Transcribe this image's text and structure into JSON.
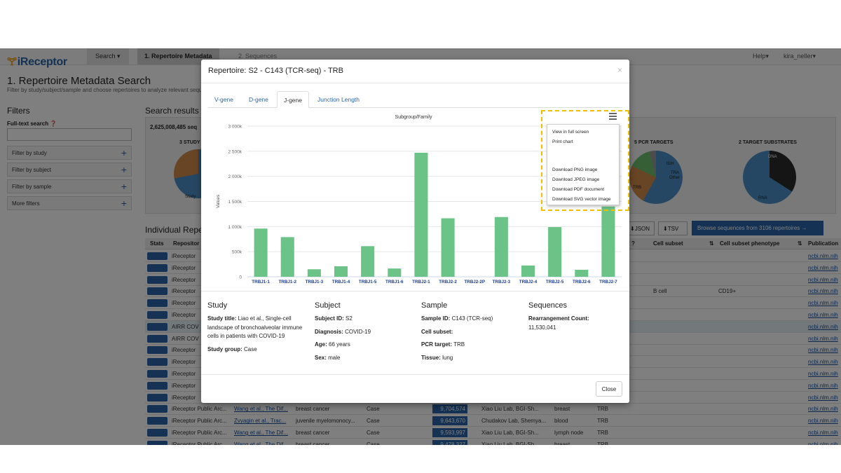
{
  "app": {
    "logo": "iReceptor",
    "nav": {
      "search": "Search ▾",
      "step1": "1. Repertoire Metadata",
      "step2": "2. Sequences",
      "help": "Help▾",
      "user": "kira_neller▾"
    },
    "page_title": "1. Repertoire Metadata Search",
    "page_subtitle": "Filter by study/subject/sample and choose repertoires to analyze relevant sequences.",
    "filters": {
      "heading": "Filters",
      "fulltext_label": "Full-text search",
      "rows": [
        "Filter by study",
        "Filter by subject",
        "Filter by sample",
        "More filters"
      ]
    },
    "results": {
      "heading": "Search results",
      "count": "2,625,008,485 seq",
      "pies": [
        {
          "title": "3 STUDY",
          "labels": [
            "Study"
          ]
        },
        {
          "title": "5 PCR TARGETS",
          "labels": [
            "IGH",
            "TRA",
            "Other",
            "TRB"
          ]
        },
        {
          "title": "2 TARGET SUBSTRATES",
          "labels": [
            "DNA",
            "RNA"
          ]
        }
      ]
    },
    "individual": {
      "heading": "Individual Repe",
      "json_btn": "JSON",
      "tsv_btn": "TSV",
      "browse_btn": "Browse sequences from 3106 repertoires →"
    },
    "table": {
      "headers": {
        "stats": "Stats",
        "repository": "Repositor",
        "q1": "?",
        "cell_subset": "Cell subset",
        "cell_phenotype": "Cell subset phenotype",
        "publication": "Publication"
      },
      "rows": [
        {
          "repo": "iReceptor",
          "pub": "ncbi.nlm.nih"
        },
        {
          "repo": "iReceptor",
          "pub": "ncbi.nlm.nih"
        },
        {
          "repo": "iReceptor",
          "pub": "ncbi.nlm.nih"
        },
        {
          "repo": "iReceptor",
          "cell": "B cell",
          "phen": "CD19+",
          "pub": "ncbi.nlm.nih"
        },
        {
          "repo": "iReceptor",
          "pub": "ncbi.nlm.nih"
        },
        {
          "repo": "iReceptor",
          "pub": "ncbi.nlm.nih"
        },
        {
          "repo": "AIRR COV",
          "pub": "ncbi.nlm.nih",
          "highlight": true
        },
        {
          "repo": "AIRR COV",
          "pub": "ncbi.nlm.nih"
        },
        {
          "repo": "iReceptor",
          "pub": "ncbi.nlm.nih"
        },
        {
          "repo": "iReceptor",
          "pub": "ncbi.nlm.nih"
        },
        {
          "repo": "iReceptor",
          "pub": "ncbi.nlm.nih"
        },
        {
          "repo": "iReceptor",
          "pub": "ncbi.nlm.nih"
        },
        {
          "repo": "iReceptor",
          "pub": "ncbi.nlm.nih"
        },
        {
          "repo": "iReceptor Public Arc...",
          "study": "Wang et al., The Dif...",
          "disease": "breast cancer",
          "group": "Case",
          "seq": "9,704,574",
          "lab": "Xiao Liu Lab, BGI-Sh...",
          "tissue": "breast",
          "target": "TRB",
          "pub": "ncbi.nlm.nih"
        },
        {
          "repo": "iReceptor Public Arc...",
          "study": "Zvyagin et al., Trac...",
          "disease": "juvenile myelomonocy...",
          "group": "Case",
          "seq": "9,643,670",
          "lab": "Chudakov Lab, Shemya...",
          "tissue": "blood",
          "target": "TRB",
          "pub": "ncbi.nlm.nih"
        },
        {
          "repo": "iReceptor Public Arc...",
          "study": "Wang et al., The Dif...",
          "disease": "breast cancer",
          "group": "Case",
          "seq": "9,593,997",
          "lab": "Xiao Liu Lab, BGI-Sh...",
          "tissue": "lymph node",
          "target": "TRB",
          "pub": "ncbi.nlm.nih"
        },
        {
          "repo": "iReceptor Public Arc...",
          "study": "Wang et al., The Dif...",
          "disease": "breast cancer",
          "group": "Case",
          "seq": "9,478,327",
          "lab": "Xiao Liu Lab, BGI-Sh...",
          "tissue": "breast",
          "target": "TRB",
          "pub": "ncbi.nlm.nih"
        }
      ]
    }
  },
  "modal": {
    "title": "Repertoire: S2 - C143 (TCR-seq) - TRB",
    "close_x": "×",
    "tabs": [
      "V-gene",
      "D-gene",
      "J-gene",
      "Junction Length"
    ],
    "active_tab": 2,
    "export_menu": {
      "items": [
        "View in full screen",
        "Print chart",
        "Download PNG image",
        "Download JPEG image",
        "Download PDF document",
        "Download SVG vector image"
      ]
    },
    "details": {
      "study": {
        "heading": "Study",
        "title_label": "Study title:",
        "title_value": "Liao et al., Single-cell landscape of bronchoalveolar immune cells in patients with COVID-19",
        "group_label": "Study group:",
        "group_value": "Case"
      },
      "subject": {
        "heading": "Subject",
        "id_label": "Subject ID:",
        "id_value": "S2",
        "diag_label": "Diagnosis:",
        "diag_value": "COVID-19",
        "age_label": "Age:",
        "age_value": "66 years",
        "sex_label": "Sex:",
        "sex_value": "male"
      },
      "sample": {
        "heading": "Sample",
        "id_label": "Sample ID:",
        "id_value": "C143 (TCR-seq)",
        "cell_label": "Cell subset:",
        "cell_value": "",
        "pcr_label": "PCR target:",
        "pcr_value": "TRB",
        "tissue_label": "Tissue:",
        "tissue_value": "lung"
      },
      "sequences": {
        "heading": "Sequences",
        "count_label": "Rearrangement Count:",
        "count_value": "11,530,041"
      }
    },
    "close_button": "Close"
  },
  "chart_data": {
    "type": "bar",
    "title": "Subgroup/Family",
    "ylabel": "Values",
    "xlabel": "",
    "ylim": [
      0,
      3000000
    ],
    "yticks": [
      0,
      500000,
      1000000,
      1500000,
      2000000,
      2500000,
      3000000
    ],
    "ytick_labels": [
      "0",
      "500k",
      "1 000k",
      "1 500k",
      "2 000k",
      "2 500k",
      "3 000k"
    ],
    "categories": [
      "TRBJ1-1",
      "TRBJ1-2",
      "TRBJ1-3",
      "TRBJ1-4",
      "TRBJ1-5",
      "TRBJ1-6",
      "TRBJ2-1",
      "TRBJ2-2",
      "TRBJ2-2P",
      "TRBJ2-3",
      "TRBJ2-4",
      "TRBJ2-5",
      "TRBJ2-6",
      "TRBJ2-7"
    ],
    "values": [
      960000,
      790000,
      150000,
      210000,
      610000,
      165000,
      2470000,
      1165000,
      0,
      1190000,
      225000,
      990000,
      140000,
      1400000
    ],
    "bar_color": "#6cc387",
    "grid": true
  }
}
